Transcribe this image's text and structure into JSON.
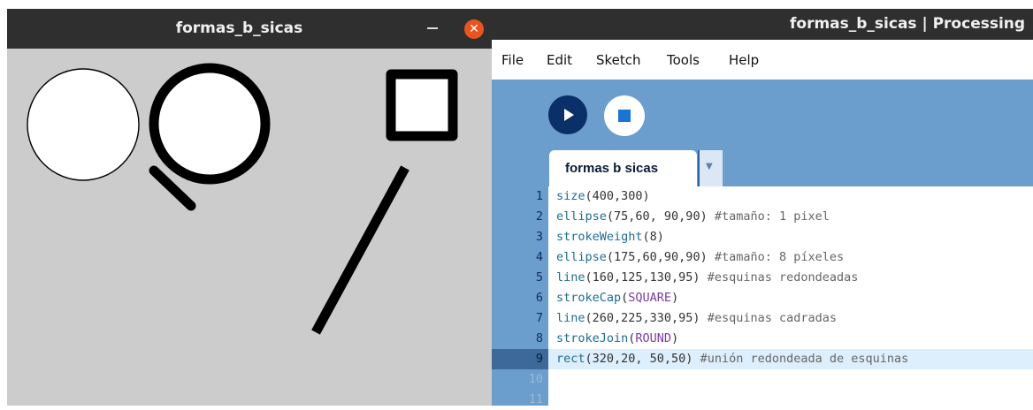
{
  "sketch_window": {
    "title": "formas_b_sicas",
    "minimize_label": "–",
    "close_label": "✕"
  },
  "ide": {
    "title": "formas_b_sicas | Processing",
    "menu": [
      "File",
      "Edit",
      "Sketch",
      "Tools",
      "Help"
    ],
    "tab_label": "formas b sicas",
    "tab_arrow": "▼",
    "active_line": 9,
    "code_lines": [
      {
        "n": "1",
        "parts": [
          [
            "fn",
            "size"
          ],
          [
            "pl",
            "(400,300)"
          ]
        ]
      },
      {
        "n": "2",
        "parts": [
          [
            "fn",
            "ellipse"
          ],
          [
            "pl",
            "(75,60, 90,90) "
          ],
          [
            "cm",
            "#tamaño: 1 pixel"
          ]
        ]
      },
      {
        "n": "3",
        "parts": [
          [
            "fn",
            "strokeWeight"
          ],
          [
            "pl",
            "(8)"
          ]
        ]
      },
      {
        "n": "4",
        "parts": [
          [
            "fn",
            "ellipse"
          ],
          [
            "pl",
            "(175,60,90,90) "
          ],
          [
            "cm",
            "#tamaño: 8 píxeles"
          ]
        ]
      },
      {
        "n": "5",
        "parts": [
          [
            "fn",
            "line"
          ],
          [
            "pl",
            "(160,125,130,95) "
          ],
          [
            "cm",
            "#esquinas redondeadas"
          ]
        ]
      },
      {
        "n": "6",
        "parts": [
          [
            "fn",
            "strokeCap"
          ],
          [
            "pl",
            "("
          ],
          [
            "cst",
            "SQUARE"
          ],
          [
            "pl",
            ")"
          ]
        ]
      },
      {
        "n": "7",
        "parts": [
          [
            "fn",
            "line"
          ],
          [
            "pl",
            "(260,225,330,95) "
          ],
          [
            "cm",
            "#esquinas cadradas"
          ]
        ]
      },
      {
        "n": "8",
        "parts": [
          [
            "fn",
            "strokeJoin"
          ],
          [
            "pl",
            "("
          ],
          [
            "cst",
            "ROUND"
          ],
          [
            "pl",
            ")"
          ]
        ]
      },
      {
        "n": "9",
        "parts": [
          [
            "fn",
            "rect"
          ],
          [
            "pl",
            "(320,20, 50,50) "
          ],
          [
            "cm",
            "#unión redondeada de esquinas"
          ]
        ]
      },
      {
        "n": "10",
        "parts": []
      },
      {
        "n": "11",
        "parts": []
      }
    ]
  },
  "colors": {
    "toolbar_blue": "#6b9dcd",
    "run_button": "#0a2f69",
    "stop_icon": "#1a74d6",
    "close_orange": "#e95420",
    "canvas_bg": "#cccccc"
  }
}
